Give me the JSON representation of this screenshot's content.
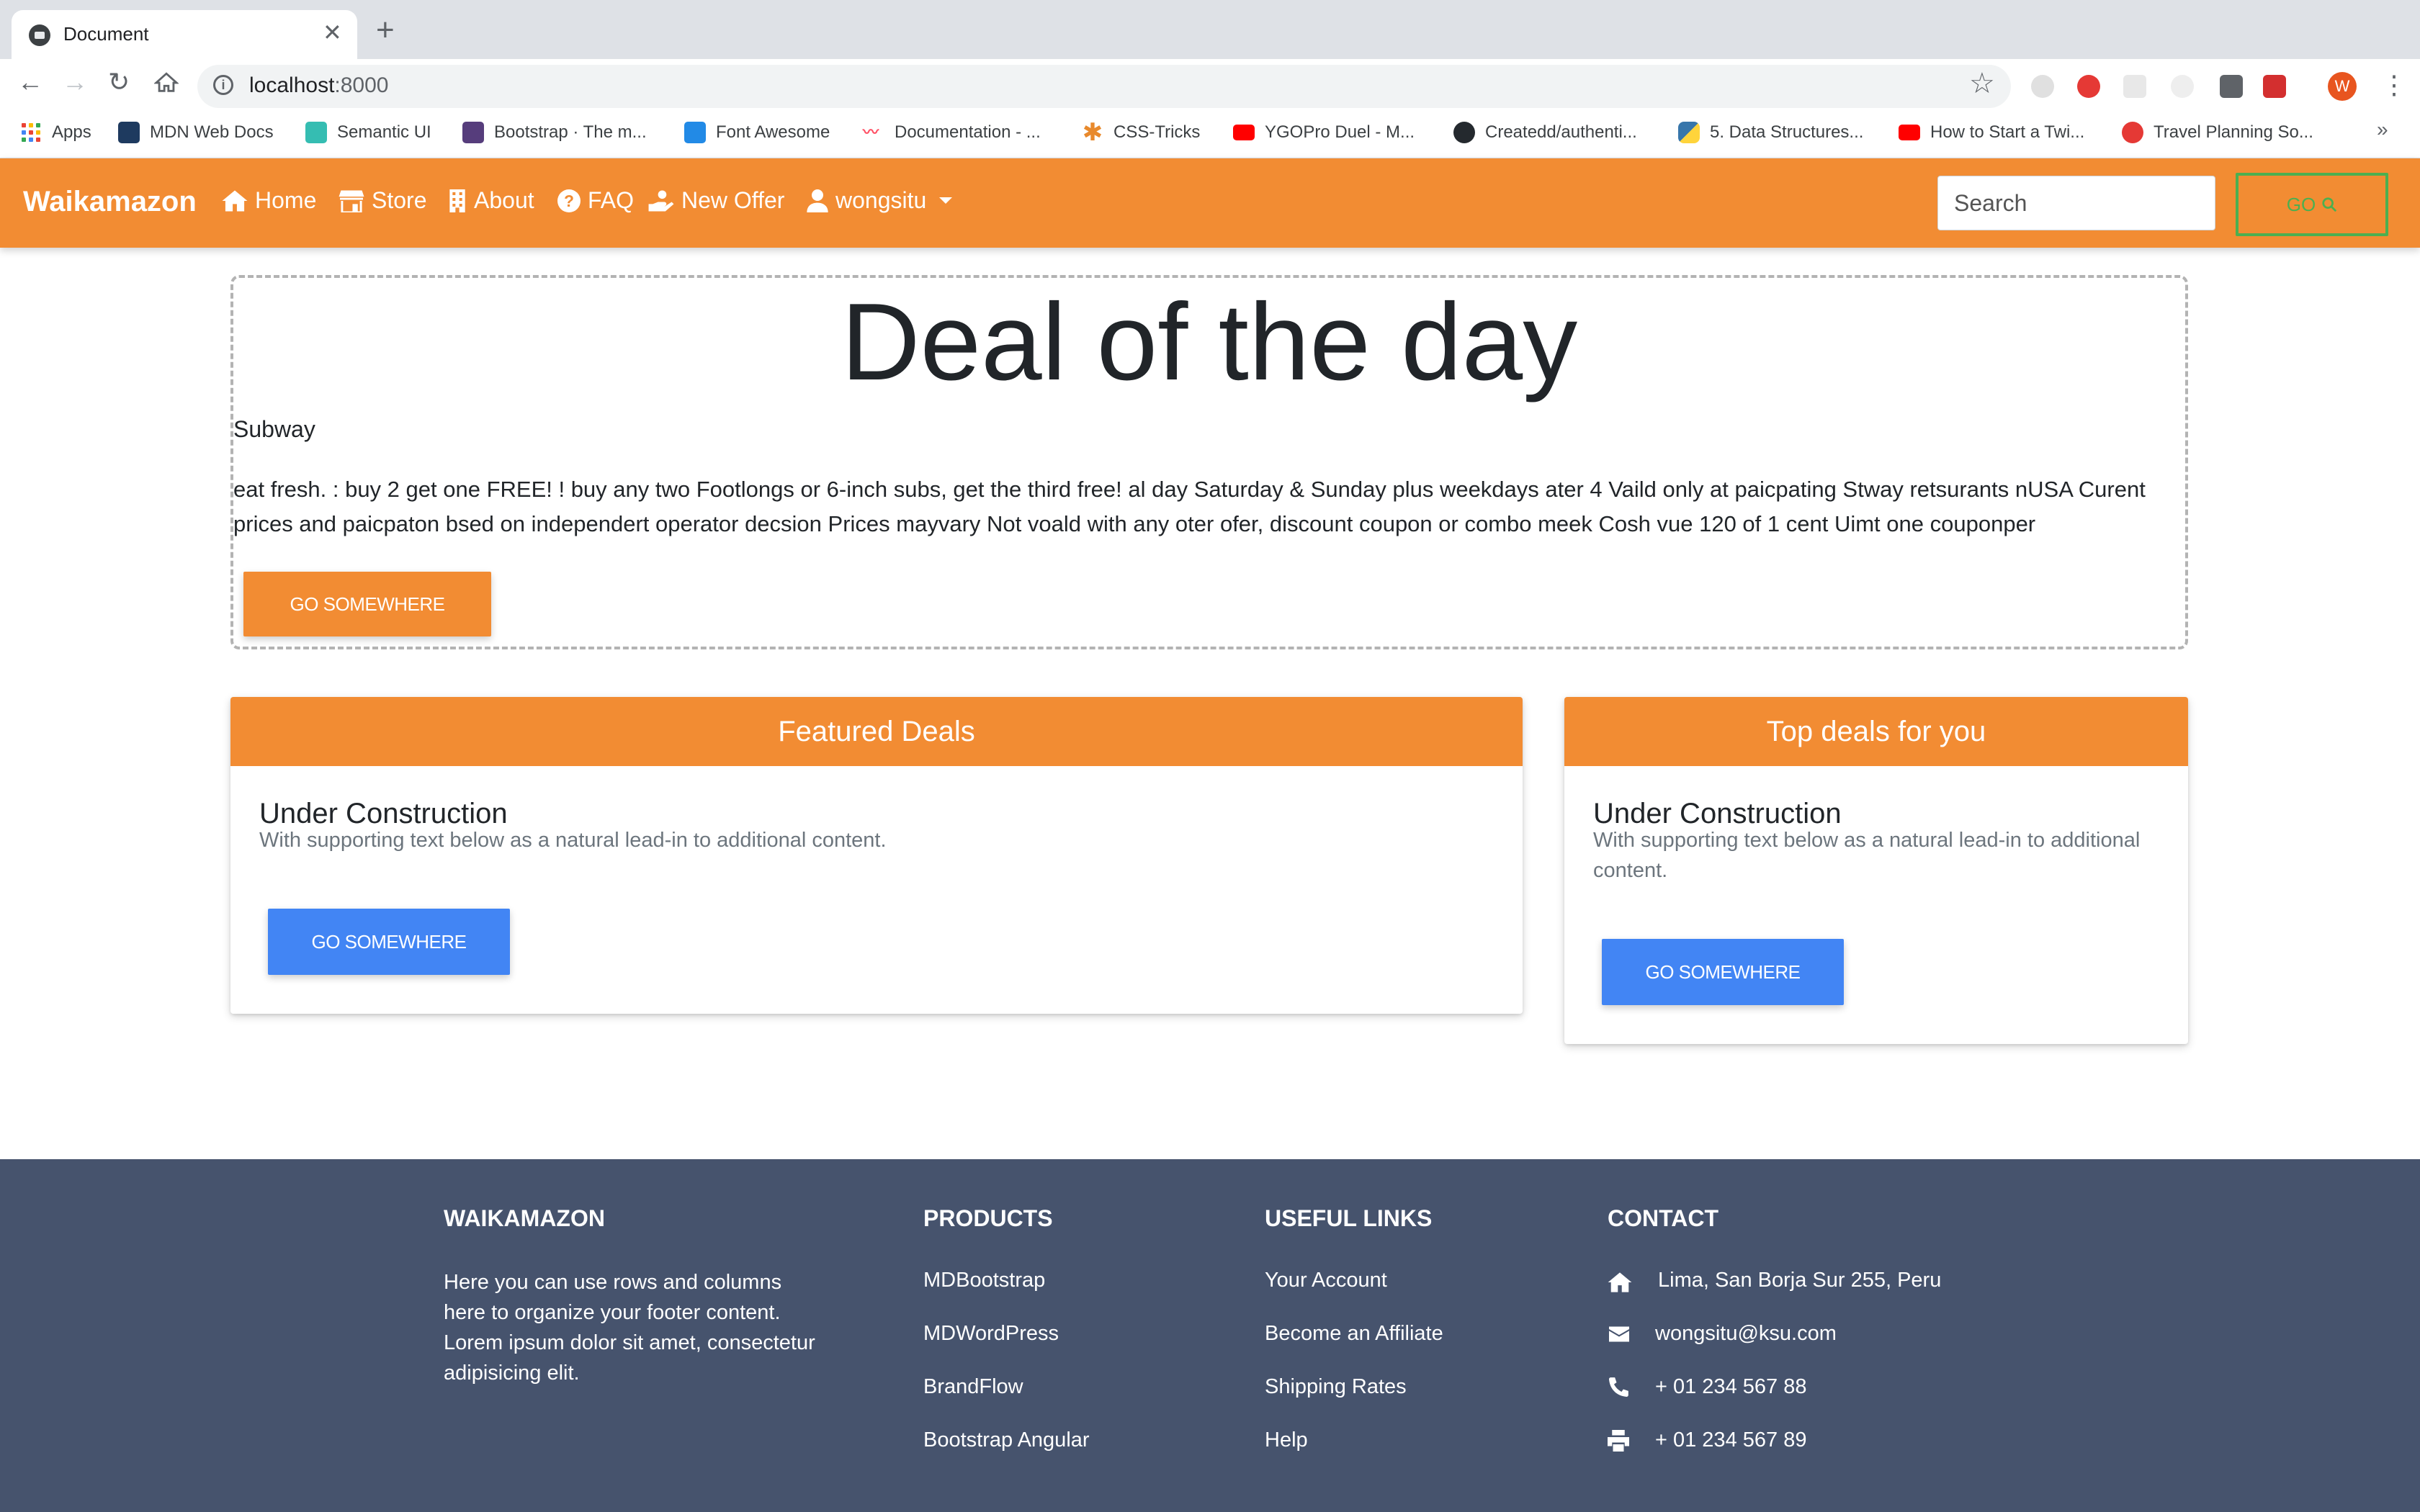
{
  "browser": {
    "tab_title": "Document",
    "url_host": "localhost",
    "url_port": ":8000",
    "profile_initial": "W",
    "bookmarks": [
      {
        "label": "Apps"
      },
      {
        "label": "MDN Web Docs"
      },
      {
        "label": "Semantic UI"
      },
      {
        "label": "Bootstrap · The m..."
      },
      {
        "label": "Font Awesome"
      },
      {
        "label": "Documentation - ..."
      },
      {
        "label": "CSS-Tricks"
      },
      {
        "label": "YGOPro Duel - M..."
      },
      {
        "label": "Createdd/authenti..."
      },
      {
        "label": "5. Data Structures..."
      },
      {
        "label": "How to Start a Twi..."
      },
      {
        "label": "Travel Planning So..."
      }
    ],
    "bookmarks_more": "»"
  },
  "navbar": {
    "brand": "Waikamazon",
    "links": [
      {
        "label": "Home",
        "icon": "home-icon"
      },
      {
        "label": "Store",
        "icon": "store-icon"
      },
      {
        "label": "About",
        "icon": "building-icon"
      },
      {
        "label": "FAQ",
        "icon": "question-circle-icon"
      },
      {
        "label": "New Offer",
        "icon": "hand-holding-icon"
      }
    ],
    "user": "wongsitu",
    "search_placeholder": "Search",
    "go_label": "GO",
    "accent": "#f28c33"
  },
  "deal": {
    "title": "Deal of the day",
    "store": "Subway",
    "text": "eat fresh. : buy 2 get one FREE! ! buy any two Footlongs or 6-inch subs, get the third free! al day Saturday & Sunday plus weekdays ater 4 Vaild only at paicpating Stway retsurants nUSA Curent prices and paicpaton bsed on independert operator decsion Prices mayvary Not voald with any oter ofer, discount coupon or combo meek Cosh vue 120 of 1 cent Uimt one couponper",
    "button": "GO SOMEWHERE"
  },
  "cards": [
    {
      "header": "Featured Deals",
      "title": "Under Construction",
      "text": "With supporting text below as a natural lead-in to additional content.",
      "button": "GO SOMEWHERE"
    },
    {
      "header": "Top deals for you",
      "title": "Under Construction",
      "text": "With supporting text below as a natural lead-in to additional content.",
      "button": "GO SOMEWHERE"
    }
  ],
  "footer": {
    "about_heading": "WAIKAMAZON",
    "about_text": "Here you can use rows and columns here to organize your footer content. Lorem ipsum dolor sit amet, consectetur adipisicing elit.",
    "products_heading": "PRODUCTS",
    "products": [
      "MDBootstrap",
      "MDWordPress",
      "BrandFlow",
      "Bootstrap Angular"
    ],
    "links_heading": "USEFUL LINKS",
    "links": [
      "Your Account",
      "Become an Affiliate",
      "Shipping Rates",
      "Help"
    ],
    "contact_heading": "CONTACT",
    "contact": [
      {
        "icon": "home-icon",
        "text": "Lima, San Borja Sur 255, Peru"
      },
      {
        "icon": "envelope-icon",
        "text": "wongsitu@ksu.com"
      },
      {
        "icon": "phone-icon",
        "text": "+ 01 234 567 88"
      },
      {
        "icon": "print-icon",
        "text": "+ 01 234 567 89"
      }
    ],
    "background": "#46536d"
  }
}
